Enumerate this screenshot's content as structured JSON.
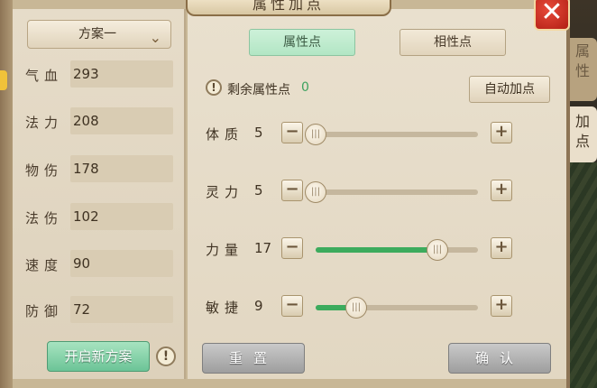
{
  "window": {
    "title": "属性加点",
    "close_glyph": "✕"
  },
  "side_tabs": [
    {
      "label": "属性"
    },
    {
      "label": "加点"
    }
  ],
  "scheme": {
    "selected": "方案一"
  },
  "stats": [
    {
      "label": "气血",
      "value": "293"
    },
    {
      "label": "法力",
      "value": "208"
    },
    {
      "label": "物伤",
      "value": "178"
    },
    {
      "label": "法伤",
      "value": "102"
    },
    {
      "label": "速度",
      "value": "90"
    },
    {
      "label": "防御",
      "value": "72"
    }
  ],
  "new_scheme_label": "开启新方案",
  "tabs": [
    {
      "label": "属性点",
      "active": true
    },
    {
      "label": "相性点",
      "active": false
    }
  ],
  "remaining": {
    "label": "剩余属性点",
    "value": "0"
  },
  "auto_label": "自动加点",
  "attributes": [
    {
      "label": "体质",
      "value": "5",
      "level": 0
    },
    {
      "label": "灵力",
      "value": "5",
      "level": 0
    },
    {
      "label": "力量",
      "value": "17",
      "level": 0.75
    },
    {
      "label": "敏捷",
      "value": "9",
      "level": 0.25
    }
  ],
  "reset_label": "重置",
  "confirm_label": "确认",
  "icons": {
    "warning": "!",
    "minus": "−",
    "plus": "+",
    "chevron": "⌄",
    "thumb": "|||"
  },
  "colors": {
    "accent_green": "#3cab5d",
    "close_red": "#c42b1c",
    "panel_bg": "#e6dcc9"
  }
}
